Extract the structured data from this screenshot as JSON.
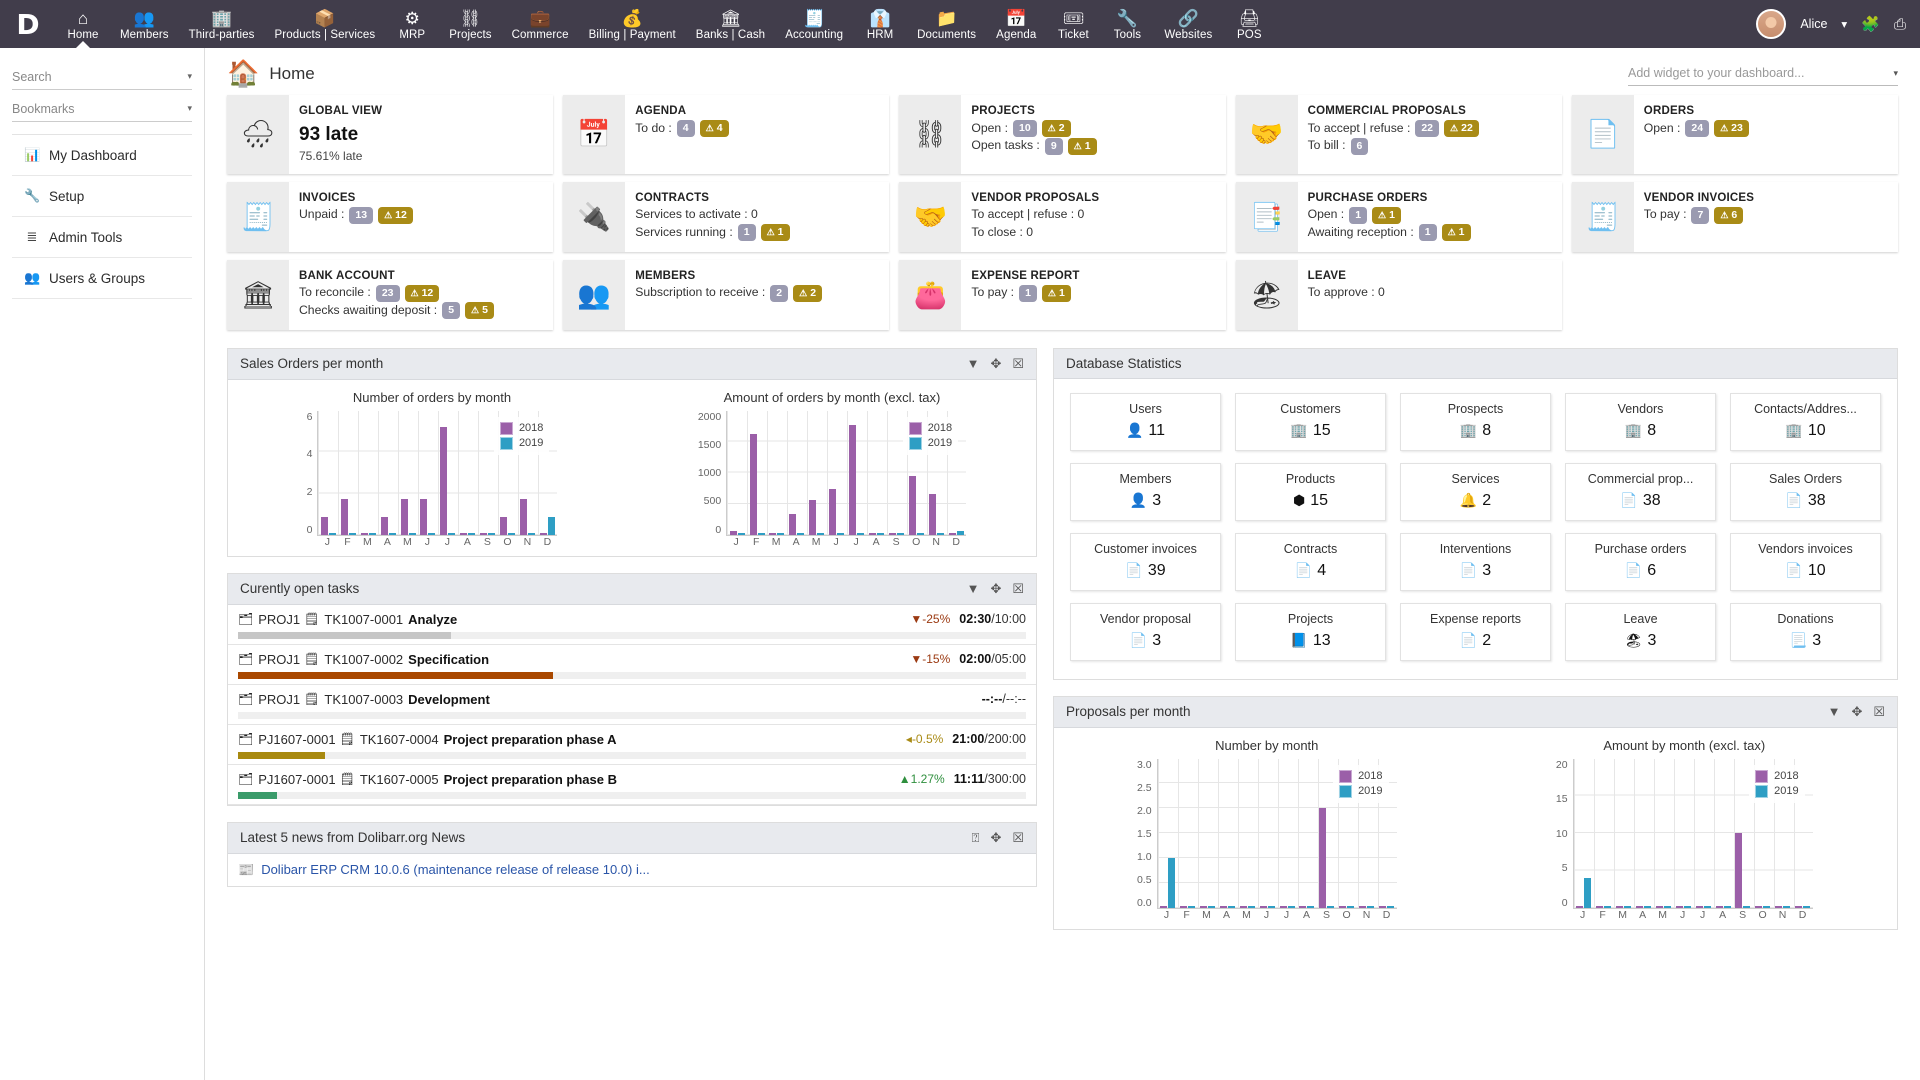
{
  "topbar": {
    "logo": "D",
    "menu": [
      {
        "label": "Home",
        "icon": "home-icon",
        "glyph": "⌂",
        "active": true
      },
      {
        "label": "Members",
        "icon": "members-icon",
        "glyph": "👥",
        "active": false
      },
      {
        "label": "Third-parties",
        "icon": "third-parties-icon",
        "glyph": "🏢",
        "active": false
      },
      {
        "label": "Products | Services",
        "icon": "products-icon",
        "glyph": "📦",
        "active": false
      },
      {
        "label": "MRP",
        "icon": "mrp-icon",
        "glyph": "⚙",
        "active": false
      },
      {
        "label": "Projects",
        "icon": "projects-icon",
        "glyph": "⛓",
        "active": false
      },
      {
        "label": "Commerce",
        "icon": "commerce-icon",
        "glyph": "💼",
        "active": false
      },
      {
        "label": "Billing | Payment",
        "icon": "billing-icon",
        "glyph": "💰",
        "active": false
      },
      {
        "label": "Banks | Cash",
        "icon": "bank-icon",
        "glyph": "🏛",
        "active": false
      },
      {
        "label": "Accounting",
        "icon": "accounting-icon",
        "glyph": "🧾",
        "active": false
      },
      {
        "label": "HRM",
        "icon": "hrm-icon",
        "glyph": "👔",
        "active": false
      },
      {
        "label": "Documents",
        "icon": "documents-icon",
        "glyph": "📁",
        "active": false
      },
      {
        "label": "Agenda",
        "icon": "agenda-icon",
        "glyph": "📅",
        "active": false
      },
      {
        "label": "Ticket",
        "icon": "ticket-icon",
        "glyph": "🎟",
        "active": false
      },
      {
        "label": "Tools",
        "icon": "tools-icon",
        "glyph": "🔧",
        "active": false
      },
      {
        "label": "Websites",
        "icon": "websites-icon",
        "glyph": "🔗",
        "active": false
      },
      {
        "label": "POS",
        "icon": "pos-icon",
        "glyph": "🖨",
        "active": false
      }
    ],
    "user": "Alice",
    "user_caret": "▾",
    "right_icons": [
      {
        "name": "modules-icon",
        "glyph": "🧩"
      },
      {
        "name": "print-icon",
        "glyph": "⎙"
      }
    ]
  },
  "sidebar": {
    "search_placeholder": "Search",
    "bookmarks_label": "Bookmarks",
    "caret": "▾",
    "items": [
      {
        "label": "My Dashboard",
        "icon": "dashboard-icon",
        "glyph": "📊"
      },
      {
        "label": "Setup",
        "icon": "wrench-icon",
        "glyph": "🔧"
      },
      {
        "label": "Admin Tools",
        "icon": "admin-tools-icon",
        "glyph": "≣"
      },
      {
        "label": "Users & Groups",
        "icon": "users-groups-icon",
        "glyph": "👥"
      }
    ]
  },
  "page": {
    "title": "Home",
    "icon": "home-page-icon",
    "glyph": "🏠",
    "add_widget_placeholder": "Add widget to your dashboard...",
    "add_widget_caret": "▾"
  },
  "kpis": [
    {
      "title": "GLOBAL VIEW",
      "icon": "rain-cloud-icon",
      "glyph": "🌧",
      "big": "93 late",
      "sub": "75.61% late",
      "lines": []
    },
    {
      "title": "AGENDA",
      "icon": "calendar-icon",
      "glyph": "📅",
      "lines": [
        {
          "label": "To do :",
          "badges": [
            {
              "text": "4",
              "type": "grey"
            },
            {
              "text": "4",
              "type": "warn"
            }
          ]
        }
      ]
    },
    {
      "title": "PROJECTS",
      "icon": "projects-tree-icon",
      "glyph": "⛓",
      "lines": [
        {
          "label": "Open :",
          "badges": [
            {
              "text": "10",
              "type": "grey"
            },
            {
              "text": "2",
              "type": "warn"
            }
          ]
        },
        {
          "label": "Open tasks :",
          "badges": [
            {
              "text": "9",
              "type": "grey"
            },
            {
              "text": "1",
              "type": "warn"
            }
          ]
        }
      ]
    },
    {
      "title": "COMMERCIAL PROPOSALS",
      "icon": "handshake-icon",
      "glyph": "🤝",
      "lines": [
        {
          "label": "To accept | refuse :",
          "badges": [
            {
              "text": "22",
              "type": "grey"
            },
            {
              "text": "22",
              "type": "warn"
            }
          ]
        },
        {
          "label": "To bill :",
          "badges": [
            {
              "text": "6",
              "type": "grey"
            }
          ]
        }
      ]
    },
    {
      "title": "ORDERS",
      "icon": "order-doc-icon",
      "glyph": "📄",
      "lines": [
        {
          "label": "Open :",
          "badges": [
            {
              "text": "24",
              "type": "grey"
            },
            {
              "text": "23",
              "type": "warn"
            }
          ]
        }
      ]
    },
    {
      "title": "INVOICES",
      "icon": "invoice-icon",
      "glyph": "🧾",
      "lines": [
        {
          "label": "Unpaid :",
          "badges": [
            {
              "text": "13",
              "type": "grey"
            },
            {
              "text": "12",
              "type": "warn"
            }
          ]
        }
      ]
    },
    {
      "title": "CONTRACTS",
      "icon": "plug-icon",
      "glyph": "🔌",
      "lines": [
        {
          "label": "Services to activate : 0",
          "badges": []
        },
        {
          "label": "Services running :",
          "badges": [
            {
              "text": "1",
              "type": "grey"
            },
            {
              "text": "1",
              "type": "warn"
            }
          ]
        }
      ]
    },
    {
      "title": "VENDOR PROPOSALS",
      "icon": "handshake-icon",
      "glyph": "🤝",
      "lines": [
        {
          "label": "To accept | refuse : 0",
          "badges": []
        },
        {
          "label": "To close : 0",
          "badges": []
        }
      ]
    },
    {
      "title": "PURCHASE ORDERS",
      "icon": "purchase-doc-icon",
      "glyph": "📑",
      "lines": [
        {
          "label": "Open :",
          "badges": [
            {
              "text": "1",
              "type": "grey"
            },
            {
              "text": "1",
              "type": "warn"
            }
          ]
        },
        {
          "label": "Awaiting reception :",
          "badges": [
            {
              "text": "1",
              "type": "grey"
            },
            {
              "text": "1",
              "type": "warn"
            }
          ]
        }
      ]
    },
    {
      "title": "VENDOR INVOICES",
      "icon": "vendor-invoice-icon",
      "glyph": "🧾",
      "lines": [
        {
          "label": "To pay :",
          "badges": [
            {
              "text": "7",
              "type": "grey"
            },
            {
              "text": "6",
              "type": "warn"
            }
          ]
        }
      ]
    },
    {
      "title": "BANK ACCOUNT",
      "icon": "bank-building-icon",
      "glyph": "🏛",
      "lines": [
        {
          "label": "To reconcile :",
          "badges": [
            {
              "text": "23",
              "type": "grey"
            },
            {
              "text": "12",
              "type": "warn"
            }
          ]
        },
        {
          "label": "Checks awaiting deposit :",
          "badges": [
            {
              "text": "5",
              "type": "grey"
            },
            {
              "text": "5",
              "type": "warn"
            }
          ]
        }
      ]
    },
    {
      "title": "MEMBERS",
      "icon": "members-group-icon",
      "glyph": "👥",
      "lines": [
        {
          "label": "Subscription to receive :",
          "badges": [
            {
              "text": "2",
              "type": "grey"
            },
            {
              "text": "2",
              "type": "warn"
            }
          ]
        }
      ]
    },
    {
      "title": "EXPENSE REPORT",
      "icon": "wallet-icon",
      "glyph": "👛",
      "lines": [
        {
          "label": "To pay :",
          "badges": [
            {
              "text": "1",
              "type": "grey"
            },
            {
              "text": "1",
              "type": "warn"
            }
          ]
        }
      ]
    },
    {
      "title": "LEAVE",
      "icon": "beach-icon",
      "glyph": "🏖",
      "lines": [
        {
          "label": "To approve : 0",
          "badges": []
        }
      ]
    }
  ],
  "panels": {
    "sales_orders": {
      "title": "Sales Orders per month",
      "tools": [
        {
          "name": "filter-icon",
          "glyph": "▼"
        },
        {
          "name": "move-icon",
          "glyph": "✥"
        },
        {
          "name": "close-icon",
          "glyph": "☒"
        }
      ]
    },
    "tasks": {
      "title": "Curently open tasks",
      "tools": [
        {
          "name": "filter-icon",
          "glyph": "▼"
        },
        {
          "name": "move-icon",
          "glyph": "✥"
        },
        {
          "name": "close-icon",
          "glyph": "☒"
        }
      ],
      "rows": [
        {
          "project": "PROJ1",
          "ref": "TK1007-0001",
          "name": "Analyze",
          "pct": "-25%",
          "arrow": "▼",
          "dir": "down",
          "done": "02:30",
          "total": "10:00",
          "bar_pct": 27,
          "bar_color": "#c6c6c6"
        },
        {
          "project": "PROJ1",
          "ref": "TK1007-0002",
          "name": "Specification",
          "pct": "-15%",
          "arrow": "▼",
          "dir": "down",
          "done": "02:00",
          "total": "05:00",
          "bar_pct": 40,
          "bar_color": "#a94800"
        },
        {
          "project": "PROJ1",
          "ref": "TK1007-0003",
          "name": "Development",
          "pct": "",
          "arrow": "",
          "dir": "none",
          "done": "--:--",
          "total": "--:--",
          "bar_pct": 0,
          "bar_color": "#c6c6c6"
        },
        {
          "project": "PJ1607-0001",
          "ref": "TK1607-0004",
          "name": "Project preparation phase A",
          "pct": "-0.5%",
          "arrow": "◂",
          "dir": "flat",
          "done": "21:00",
          "total": "200:00",
          "bar_pct": 11,
          "bar_color": "#a8890f"
        },
        {
          "project": "PJ1607-0001",
          "ref": "TK1607-0005",
          "name": "Project preparation phase B",
          "pct": "1.27%",
          "arrow": "▲",
          "dir": "up",
          "done": "11:11",
          "total": "300:00",
          "bar_pct": 5,
          "bar_color": "#3a9b6a"
        }
      ]
    },
    "news": {
      "title": "Latest 5 news from Dolibarr.org News",
      "tools": [
        {
          "name": "help-icon",
          "glyph": "⍰"
        },
        {
          "name": "move-icon",
          "glyph": "✥"
        },
        {
          "name": "close-icon",
          "glyph": "☒"
        }
      ],
      "items": [
        {
          "icon": "rss-icon",
          "glyph": "📰",
          "text": "Dolibarr ERP CRM 10.0.6 (maintenance release of release 10.0) i..."
        }
      ]
    },
    "db_stats": {
      "title": "Database Statistics"
    },
    "proposals": {
      "title": "Proposals per month",
      "tools": [
        {
          "name": "filter-icon",
          "glyph": "▼"
        },
        {
          "name": "move-icon",
          "glyph": "✥"
        },
        {
          "name": "close-icon",
          "glyph": "☒"
        }
      ]
    }
  },
  "db_stats": [
    {
      "label": "Users",
      "value": "11",
      "icon": "user-icon",
      "glyph": "👤"
    },
    {
      "label": "Customers",
      "value": "15",
      "icon": "company-icon",
      "glyph": "🏢"
    },
    {
      "label": "Prospects",
      "value": "8",
      "icon": "company-icon",
      "glyph": "🏢"
    },
    {
      "label": "Vendors",
      "value": "8",
      "icon": "company-icon",
      "glyph": "🏢"
    },
    {
      "label": "Contacts/Addres...",
      "value": "10",
      "icon": "contact-icon",
      "glyph": "🏢"
    },
    {
      "label": "Members",
      "value": "3",
      "icon": "user-icon",
      "glyph": "👤"
    },
    {
      "label": "Products",
      "value": "15",
      "icon": "product-icon",
      "glyph": "⬢"
    },
    {
      "label": "Services",
      "value": "2",
      "icon": "service-icon",
      "glyph": "🔔"
    },
    {
      "label": "Commercial prop...",
      "value": "38",
      "icon": "proposal-doc-icon",
      "glyph": "📄"
    },
    {
      "label": "Sales Orders",
      "value": "38",
      "icon": "order-doc-icon",
      "glyph": "📄"
    },
    {
      "label": "Customer invoices",
      "value": "39",
      "icon": "invoice-doc-icon",
      "glyph": "📄"
    },
    {
      "label": "Contracts",
      "value": "4",
      "icon": "contract-doc-icon",
      "glyph": "📄"
    },
    {
      "label": "Interventions",
      "value": "3",
      "icon": "intervention-doc-icon",
      "glyph": "📄"
    },
    {
      "label": "Purchase orders",
      "value": "6",
      "icon": "purchase-doc-icon",
      "glyph": "📄"
    },
    {
      "label": "Vendors invoices",
      "value": "10",
      "icon": "vendor-invoice-doc-icon",
      "glyph": "📄"
    },
    {
      "label": "Vendor proposal",
      "value": "3",
      "icon": "vendor-proposal-doc-icon",
      "glyph": "📄"
    },
    {
      "label": "Projects",
      "value": "13",
      "icon": "project-doc-icon",
      "glyph": "📘"
    },
    {
      "label": "Expense reports",
      "value": "2",
      "icon": "expense-doc-icon",
      "glyph": "📄"
    },
    {
      "label": "Leave",
      "value": "3",
      "icon": "leave-icon",
      "glyph": "🏖"
    },
    {
      "label": "Donations",
      "value": "3",
      "icon": "donation-doc-icon",
      "glyph": "📃"
    }
  ],
  "chart_data": [
    {
      "type": "bar",
      "id": "orders_number",
      "title": "Number of orders by month",
      "categories": [
        "J",
        "F",
        "M",
        "A",
        "M",
        "J",
        "J",
        "A",
        "S",
        "O",
        "N",
        "D"
      ],
      "series": [
        {
          "name": "2018",
          "color": "#9b5fa8",
          "values": [
            1,
            2,
            0,
            1,
            2,
            2,
            6,
            0,
            0,
            1,
            2,
            0
          ]
        },
        {
          "name": "2019",
          "color": "#2e9ec4",
          "values": [
            0,
            0,
            0,
            0,
            0,
            0,
            0,
            0,
            0,
            0,
            0,
            1
          ]
        }
      ],
      "ylim": [
        0,
        7
      ],
      "yticks": [
        0,
        2,
        4,
        6
      ],
      "xlabel": "",
      "ylabel": "",
      "grid": true,
      "legend": "top-right"
    },
    {
      "type": "bar",
      "id": "orders_amount",
      "title": "Amount of orders by month (excl. tax)",
      "categories": [
        "J",
        "F",
        "M",
        "A",
        "M",
        "J",
        "J",
        "A",
        "S",
        "O",
        "N",
        "D"
      ],
      "series": [
        {
          "name": "2018",
          "color": "#9b5fa8",
          "values": [
            50,
            1610,
            0,
            335,
            560,
            735,
            1755,
            0,
            0,
            940,
            645,
            0
          ]
        },
        {
          "name": "2019",
          "color": "#2e9ec4",
          "values": [
            0,
            0,
            0,
            0,
            0,
            0,
            0,
            0,
            0,
            0,
            0,
            50
          ]
        }
      ],
      "ylim": [
        0,
        2000
      ],
      "yticks": [
        0,
        500,
        1000,
        1500,
        2000
      ],
      "xlabel": "",
      "ylabel": "",
      "grid": true,
      "legend": "top-right"
    },
    {
      "type": "bar",
      "id": "proposals_number",
      "title": "Number by month",
      "categories": [
        "J",
        "F",
        "M",
        "A",
        "M",
        "J",
        "J",
        "A",
        "S",
        "O",
        "N",
        "D"
      ],
      "series": [
        {
          "name": "2018",
          "color": "#9b5fa8",
          "values": [
            0,
            0,
            0,
            0,
            0,
            0,
            0,
            0,
            2,
            0,
            0,
            0
          ]
        },
        {
          "name": "2019",
          "color": "#2e9ec4",
          "values": [
            1,
            0,
            0,
            0,
            0,
            0,
            0,
            0,
            0,
            0,
            0,
            0
          ]
        }
      ],
      "ylim": [
        0,
        3
      ],
      "yticks": [
        "3.0",
        "2.5",
        "2.0",
        "1.5",
        "1.0",
        "0.5",
        "0.0"
      ],
      "xlabel": "",
      "ylabel": "",
      "grid": true,
      "legend": "top-right"
    },
    {
      "type": "bar",
      "id": "proposals_amount",
      "title": "Amount by month (excl. tax)",
      "categories": [
        "J",
        "F",
        "M",
        "A",
        "M",
        "J",
        "J",
        "A",
        "S",
        "O",
        "N",
        "D"
      ],
      "series": [
        {
          "name": "2018",
          "color": "#9b5fa8",
          "values": [
            0,
            0,
            0,
            0,
            0,
            0,
            0,
            0,
            10,
            0,
            0,
            0
          ]
        },
        {
          "name": "2019",
          "color": "#2e9ec4",
          "values": [
            4,
            0,
            0,
            0,
            0,
            0,
            0,
            0,
            0,
            0,
            0,
            0
          ]
        }
      ],
      "ylim": [
        0,
        20
      ],
      "yticks": [
        20,
        15,
        10,
        5,
        0
      ],
      "xlabel": "",
      "ylabel": "",
      "grid": true,
      "legend": "top-right"
    }
  ]
}
